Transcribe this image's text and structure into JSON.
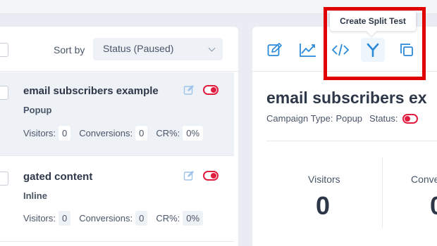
{
  "sortbar": {
    "label": "Sort by",
    "selected": "Status (Paused)"
  },
  "campaigns": [
    {
      "title": "email subscribers example",
      "type": "Popup",
      "visitors_label": "Visitors:",
      "visitors": "0",
      "conversions_label": "Conversions:",
      "conversions": "0",
      "cr_label": "CR%:",
      "cr": "0%",
      "selected": true
    },
    {
      "title": "gated content",
      "type": "Inline",
      "visitors_label": "Visitors:",
      "visitors": "0",
      "conversions_label": "Conversions:",
      "conversions": "0",
      "cr_label": "CR%:",
      "cr": "0%",
      "selected": false
    }
  ],
  "toolbar": {
    "icons": [
      "edit-icon",
      "chart-icon",
      "code-icon",
      "split-test-icon",
      "duplicate-icon"
    ],
    "tooltip": "Create Split Test"
  },
  "detail": {
    "title": "email subscribers ex",
    "campaign_type_label": "Campaign Type:",
    "campaign_type": "Popup",
    "status_label": "Status:",
    "visitors_label": "Visitors",
    "visitors": "0",
    "conversions_label": "Conve",
    "conversions": "0"
  },
  "colors": {
    "accent": "#2b8ad8",
    "toggle_off": "#e11d3f",
    "highlight": "#e10000"
  }
}
